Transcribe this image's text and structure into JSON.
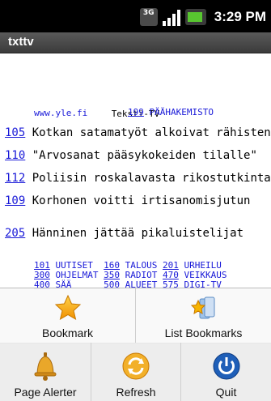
{
  "status_bar": {
    "network": "3G",
    "time": "3:29 PM"
  },
  "app": {
    "title": "txttv"
  },
  "teletext": {
    "header": "Teksti-TV",
    "site": "www.yle.fi",
    "home_page_number": "199",
    "home_page_label": "PÄÄHAKEMISTO",
    "news": [
      {
        "page": "105",
        "text": "Kotkan satamatyöt alkoivat rähisten"
      },
      {
        "page": "110",
        "text": "\"Arvosanat pääsykokeiden tilalle\""
      },
      {
        "page": "112",
        "text": "Poliisin roskalavasta rikostutkinta"
      },
      {
        "page": "109",
        "text": "Korhonen voitti irtisanomisjutun"
      },
      {
        "page": "205",
        "text": "Hänninen jättää pikaluistelijat"
      }
    ],
    "index_rows": [
      [
        {
          "page": "101",
          "label": "UUTISET"
        },
        {
          "page": "160",
          "label": "TALOUS"
        },
        {
          "page": "201",
          "label": "URHEILU"
        }
      ],
      [
        {
          "page": "300",
          "label": "OHJELMAT"
        },
        {
          "page": "350",
          "label": "RADIOT"
        },
        {
          "page": "470",
          "label": "VEIKKAUS"
        }
      ],
      [
        {
          "page": "400",
          "label": "SÄÄ"
        },
        {
          "page": "500",
          "label": "ALUEET"
        },
        {
          "page": "575",
          "label": "DIGI-TV"
        }
      ]
    ]
  },
  "menu": {
    "bookmark": "Bookmark",
    "list_bookmarks": "List Bookmarks",
    "page_alerter": "Page Alerter",
    "refresh": "Refresh",
    "quit": "Quit"
  },
  "icons": {
    "bookmark": "star-icon",
    "list_bookmarks": "star-folder-icon",
    "page_alerter": "bell-icon",
    "refresh": "refresh-icon",
    "quit": "power-icon"
  },
  "colors": {
    "link": "#1a1ad8",
    "battery": "#58c630",
    "accent": "#f0a000"
  }
}
